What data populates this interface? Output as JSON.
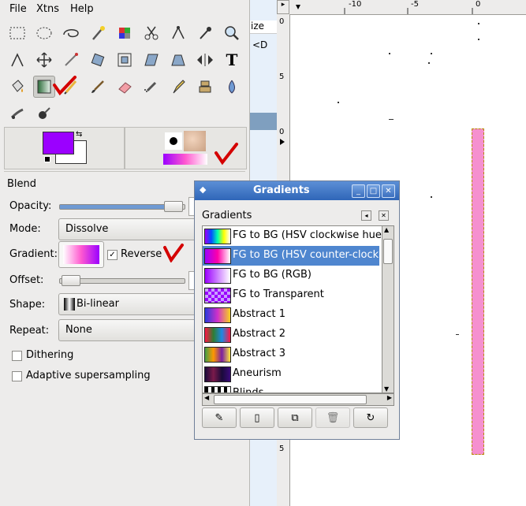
{
  "menubar": {
    "file": "File",
    "xtns": "Xtns",
    "help": "Help"
  },
  "tools": [
    "rect-select",
    "ellipse-select",
    "free-select",
    "fuzzy-select",
    "color-select",
    "scissors",
    "paths",
    "color-picker",
    "zoom",
    "measure",
    "move",
    "crop",
    "rotate",
    "scale",
    "shear",
    "perspective",
    "flip",
    "text",
    "bucket-fill",
    "blend",
    "pencil",
    "paintbrush",
    "eraser",
    "airbrush",
    "ink",
    "clone",
    "convolve",
    "smudge",
    "dodge-burn"
  ],
  "colors": {
    "fg": "#9b00ff",
    "bg": "#ffffff",
    "accent_check": "#d40000"
  },
  "blend": {
    "title": "Blend",
    "opacity_label": "Opacity:",
    "opacity_value": 1.0,
    "mode_label": "Mode:",
    "mode_value": "Dissolve",
    "gradient_label": "Gradient:",
    "reverse_label": "Reverse",
    "reverse_checked": true,
    "offset_label": "Offset:",
    "offset_value": 0,
    "shape_label": "Shape:",
    "shape_value": "Bi-linear",
    "repeat_label": "Repeat:",
    "repeat_value": "None",
    "dithering_label": "Dithering",
    "supersampling_label": "Adaptive supersampling"
  },
  "canvas": {
    "tab_label": "ize",
    "row_text": "<D",
    "ruler_top_labels": [
      "-10",
      "-5",
      "0"
    ],
    "ruler_left_labels": [
      "0",
      "5",
      "0",
      "5"
    ]
  },
  "dialog": {
    "title": "Gradients",
    "subtitle": "Gradients",
    "selected_index": 1,
    "gradients": [
      {
        "name": "FG to BG (HSV clockwise hue"
      },
      {
        "name": "FG to BG (HSV counter-clock"
      },
      {
        "name": "FG to BG (RGB)"
      },
      {
        "name": "FG to Transparent"
      },
      {
        "name": "Abstract 1"
      },
      {
        "name": "Abstract 2"
      },
      {
        "name": "Abstract 3"
      },
      {
        "name": "Aneurism"
      },
      {
        "name": "Blinds"
      }
    ],
    "buttons": [
      "edit-gradient",
      "new-gradient",
      "duplicate-gradient",
      "delete-gradient",
      "refresh-gradients"
    ]
  }
}
